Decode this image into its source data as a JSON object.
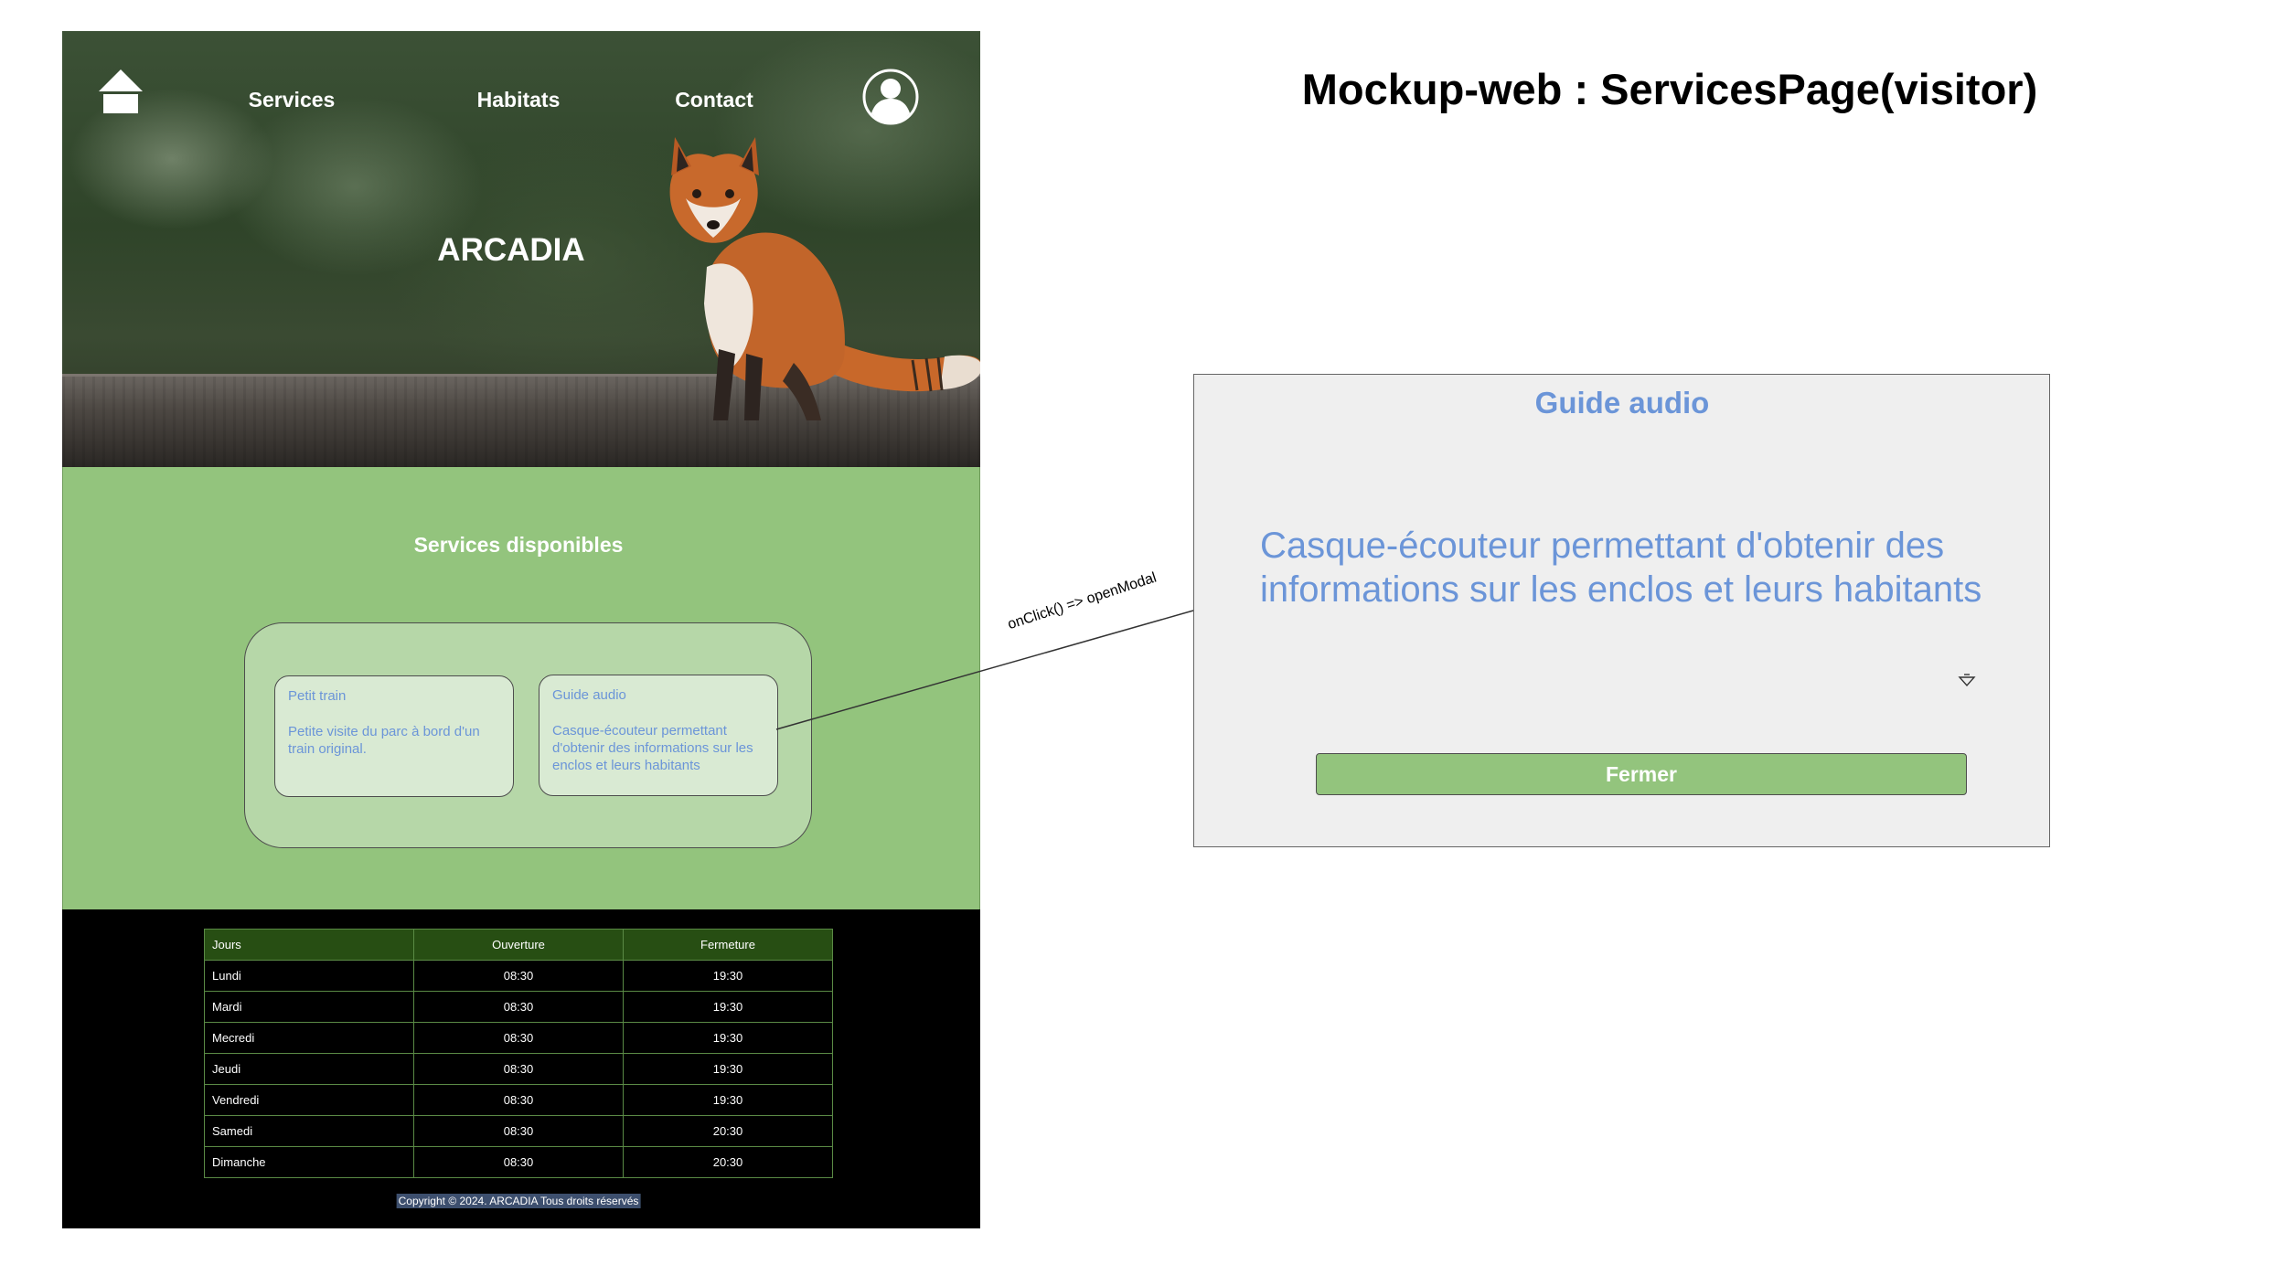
{
  "page": {
    "heading": "Mockup-web : ServicesPage(visitor)"
  },
  "nav": {
    "home_icon": "home-icon",
    "links": [
      "Services",
      "Habitats",
      "Contact"
    ],
    "user_icon": "user-icon"
  },
  "hero": {
    "title": "ARCADIA"
  },
  "services": {
    "title": "Services disponibles",
    "cards": [
      {
        "title": "Petit train",
        "desc": "Petite visite du parc à bord d'un train original."
      },
      {
        "title": "Guide audio",
        "desc": "Casque-écouteur permettant d'obtenir des informations sur les enclos et leurs habitants"
      }
    ]
  },
  "hours_table": {
    "headers": [
      "Jours",
      "Ouverture",
      "Fermeture"
    ],
    "rows": [
      [
        "Lundi",
        "08:30",
        "19:30"
      ],
      [
        "Mardi",
        "08:30",
        "19:30"
      ],
      [
        "Mecredi",
        "08:30",
        "19:30"
      ],
      [
        "Jeudi",
        "08:30",
        "19:30"
      ],
      [
        "Vendredi",
        "08:30",
        "19:30"
      ],
      [
        "Samedi",
        "08:30",
        "20:30"
      ],
      [
        "Dimanche",
        "08:30",
        "20:30"
      ]
    ]
  },
  "footer": {
    "copyright": "Copyright © 2024. ARCADIA Tous droits réservés"
  },
  "connector": {
    "label": "onClick() => openModal"
  },
  "modal": {
    "title": "Guide audio",
    "text": "Casque-écouteur permettant d'obtenir des informations sur les enclos et leurs habitants",
    "icon": "return-arrow-icon",
    "close_label": "Fermer"
  },
  "colors": {
    "services_bg": "#93c47d",
    "box_bg": "#b6d7a8",
    "card_bg": "#d9ead3",
    "accent_text": "#6b95d8",
    "table_header": "#274e13",
    "modal_bg": "#efefef"
  }
}
